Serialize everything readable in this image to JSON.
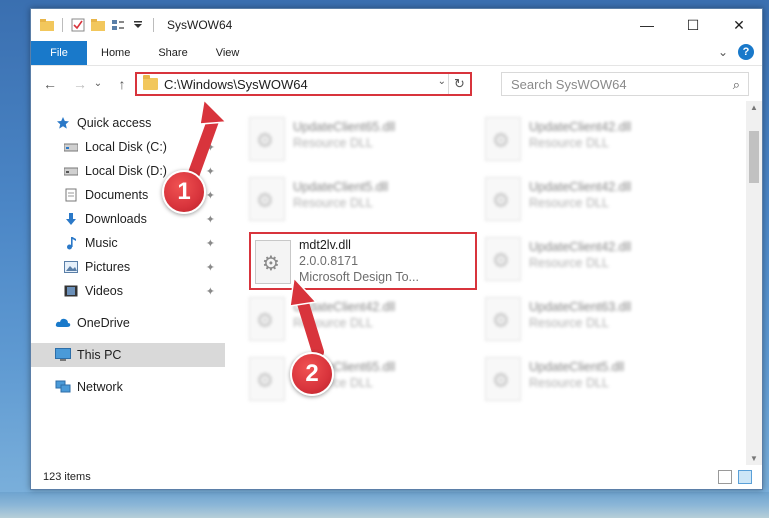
{
  "window": {
    "title": "SysWOW64"
  },
  "controls": {
    "minimize": "—",
    "maximize": "☐",
    "close": "✕"
  },
  "ribbon": {
    "tabs": [
      "File",
      "Home",
      "Share",
      "View"
    ],
    "expand": "⌄",
    "help": "?"
  },
  "nav": {
    "back": "←",
    "forward": "→",
    "recent": "⌄",
    "up": "↑",
    "address": "C:\\Windows\\SysWOW64",
    "address_dropdown": "⌄",
    "refresh": "↻",
    "search_placeholder": "Search SysWOW64",
    "search_icon": "⌕"
  },
  "sidebar": {
    "items": [
      {
        "label": "Quick access",
        "icon": "star-icon",
        "level": 1,
        "pinned": false
      },
      {
        "label": "Local Disk (C:)",
        "icon": "drive-icon",
        "level": 2,
        "pinned": true
      },
      {
        "label": "Local Disk (D:)",
        "icon": "drive-icon",
        "level": 2,
        "pinned": true
      },
      {
        "label": "Documents",
        "icon": "documents-icon",
        "level": 2,
        "pinned": true
      },
      {
        "label": "Downloads",
        "icon": "download-icon",
        "level": 2,
        "pinned": true
      },
      {
        "label": "Music",
        "icon": "music-icon",
        "level": 2,
        "pinned": true
      },
      {
        "label": "Pictures",
        "icon": "pictures-icon",
        "level": 2,
        "pinned": true
      },
      {
        "label": "Videos",
        "icon": "videos-icon",
        "level": 2,
        "pinned": true
      },
      {
        "label": "OneDrive",
        "icon": "cloud-icon",
        "level": 1,
        "pinned": false
      },
      {
        "label": "This PC",
        "icon": "computer-icon",
        "level": 1,
        "pinned": false,
        "selected": true
      },
      {
        "label": "Network",
        "icon": "network-icon",
        "level": 1,
        "pinned": false
      }
    ],
    "pin_glyph": "📌"
  },
  "files": {
    "tiles": [
      {
        "name": "UpdateClient65.dll",
        "line2": "Resource DLL",
        "blurred": true
      },
      {
        "name": "UpdateClient42.dll",
        "line2": "Resource DLL",
        "blurred": true
      },
      {
        "name": "UpdateClient5.dll",
        "line2": "Resource DLL",
        "blurred": true
      },
      {
        "name": "UpdateClient42.dll",
        "line2": "Resource DLL",
        "blurred": true
      },
      {
        "name": "mdt2lv.dll",
        "line2": "2.0.0.8171",
        "line3": "Microsoft Design To...",
        "blurred": false,
        "highlighted": true
      },
      {
        "name": "UpdateClient42.dll",
        "line2": "Resource DLL",
        "blurred": true
      },
      {
        "name": "UpdateClient42.dll",
        "line2": "Resource DLL",
        "blurred": true
      },
      {
        "name": "UpdateClient63.dll",
        "line2": "Resource DLL",
        "blurred": true
      },
      {
        "name": "UpdateClient65.dll",
        "line2": "Resource DLL",
        "blurred": true
      },
      {
        "name": "UpdateClient5.dll",
        "line2": "Resource DLL",
        "blurred": true
      }
    ]
  },
  "status": {
    "item_count": "123 items"
  },
  "callouts": {
    "one": "1",
    "two": "2"
  },
  "colors": {
    "accent": "#1979ca",
    "highlight_red": "#d8343c",
    "selected_bg": "#d9d9d9"
  }
}
